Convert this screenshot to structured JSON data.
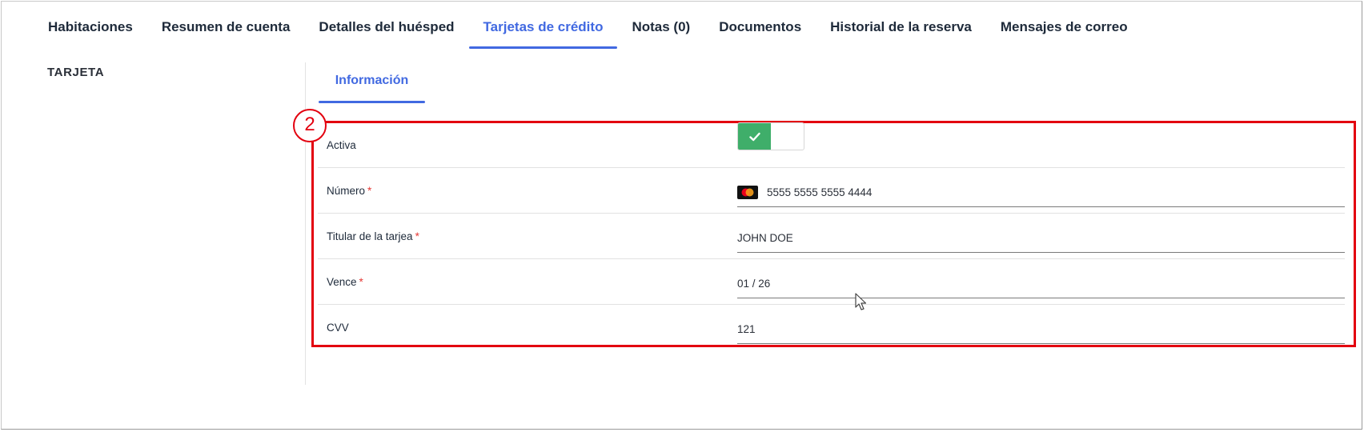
{
  "tabs": [
    {
      "label": "Habitaciones"
    },
    {
      "label": "Resumen de cuenta"
    },
    {
      "label": "Detalles del huésped"
    },
    {
      "label": "Tarjetas de crédito",
      "active": true
    },
    {
      "label": "Notas (0)"
    },
    {
      "label": "Documentos"
    },
    {
      "label": "Historial de la reserva"
    },
    {
      "label": "Mensajes de correo"
    }
  ],
  "section_label": "TARJETA",
  "inner_tab": "Información",
  "step_badge": "2",
  "form": {
    "active": {
      "label": "Activa",
      "checked": true
    },
    "number": {
      "label": "Número",
      "required_mark": "*",
      "value": "5555 5555 5555 4444",
      "icon": "mastercard-icon"
    },
    "holder": {
      "label": "Titular de la tarjea",
      "required_mark": "*",
      "value": "JOHN DOE"
    },
    "expiry": {
      "label": "Vence",
      "required_mark": "*",
      "value": "01 / 26"
    },
    "cvv": {
      "label": "CVV",
      "value": "121"
    }
  },
  "colors": {
    "accent": "#4169e1",
    "highlight": "#e3000f",
    "toggle_on": "#3fae6a",
    "required": "#e53935"
  }
}
